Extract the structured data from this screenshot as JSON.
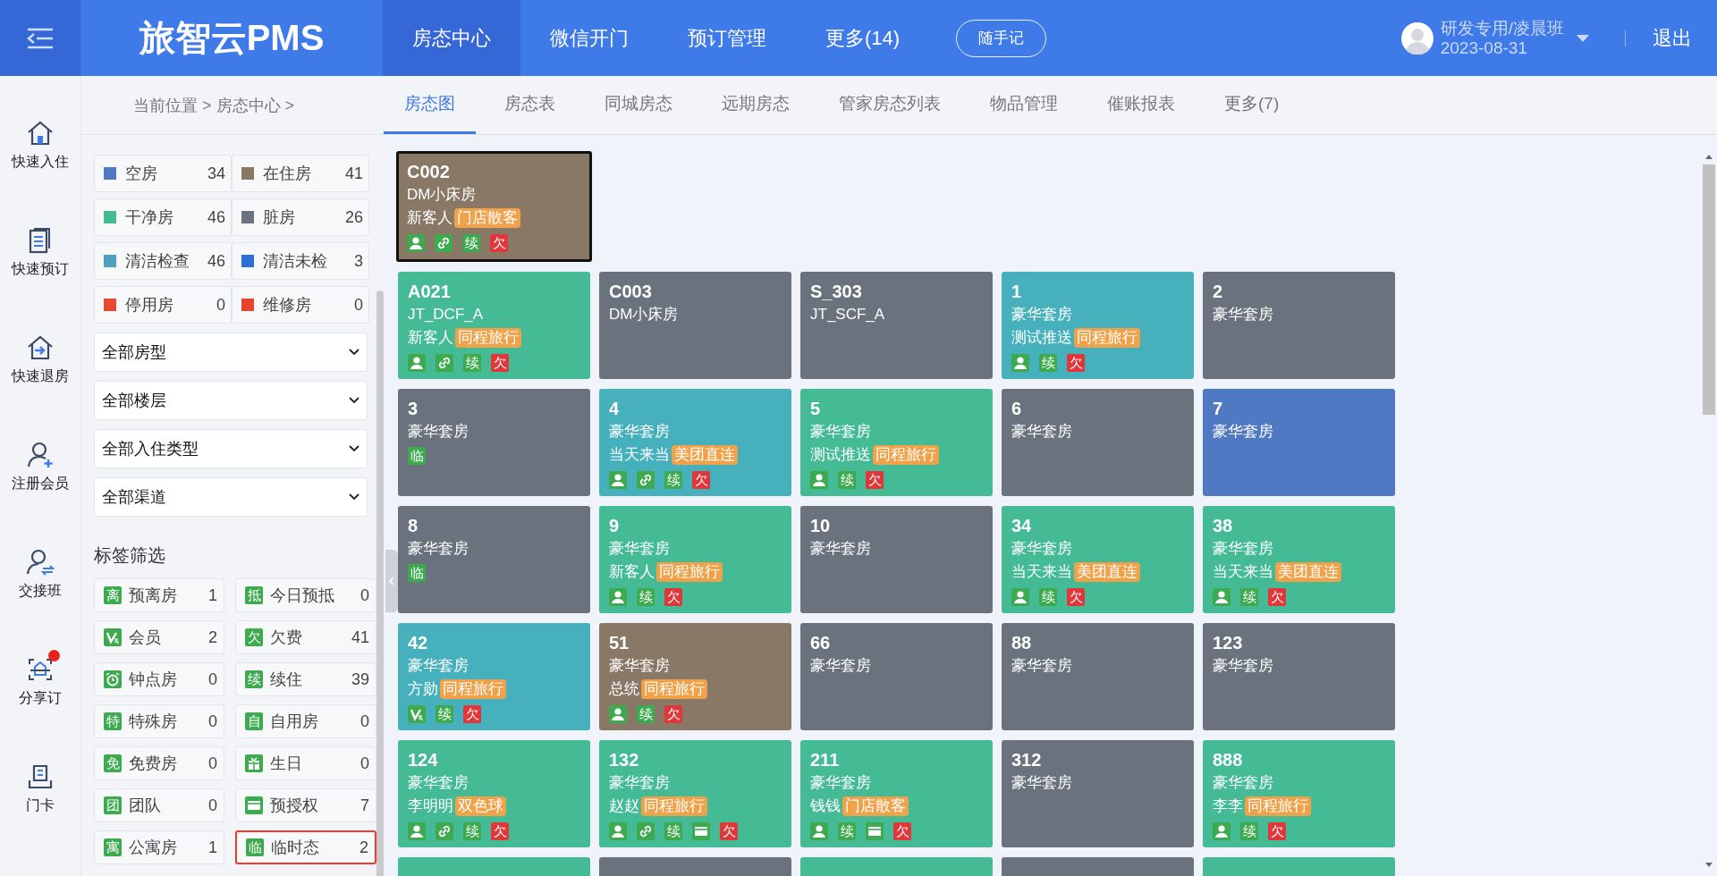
{
  "header": {
    "logo": "旅智云PMS",
    "nav": [
      {
        "label": "房态中心",
        "selected": true
      },
      {
        "label": "微信开门",
        "selected": false
      },
      {
        "label": "预订管理",
        "selected": false
      },
      {
        "label": "更多(14)",
        "selected": false
      }
    ],
    "note_button": "随手记",
    "user": {
      "name": "研发专用/凌晨班",
      "date": "2023-08-31"
    },
    "logout": "退出"
  },
  "rail": [
    {
      "label": "快速入住",
      "kind": "checkin",
      "alert": false
    },
    {
      "label": "快速预订",
      "kind": "booking",
      "alert": false
    },
    {
      "label": "快速退房",
      "kind": "checkout",
      "alert": false
    },
    {
      "label": "注册会员",
      "kind": "member",
      "alert": false
    },
    {
      "label": "交接班",
      "kind": "handover",
      "alert": false
    },
    {
      "label": "分享订",
      "kind": "share",
      "alert": true
    },
    {
      "label": "门卡",
      "kind": "card",
      "alert": false
    }
  ],
  "breadcrumb": "当前位置 > 房态中心 >",
  "tabs": [
    {
      "label": "房态图",
      "selected": true
    },
    {
      "label": "房态表",
      "selected": false
    },
    {
      "label": "同城房态",
      "selected": false
    },
    {
      "label": "远期房态",
      "selected": false
    },
    {
      "label": "管家房态列表",
      "selected": false
    },
    {
      "label": "物品管理",
      "selected": false
    },
    {
      "label": "催账报表",
      "selected": false
    },
    {
      "label": "更多(7)",
      "selected": false
    }
  ],
  "status_filters": [
    {
      "label": "空房",
      "count": "34",
      "color": "#5079c3"
    },
    {
      "label": "在住房",
      "count": "41",
      "color": "#8a7866"
    },
    {
      "label": "干净房",
      "count": "46",
      "color": "#45bb95"
    },
    {
      "label": "脏房",
      "count": "26",
      "color": "#6a737d"
    },
    {
      "label": "清洁检查",
      "count": "46",
      "color": "#4f9fc0"
    },
    {
      "label": "清洁未检",
      "count": "3",
      "color": "#2d6fd6"
    },
    {
      "label": "停用房",
      "count": "0",
      "color": "#e84a2f"
    },
    {
      "label": "维修房",
      "count": "0",
      "color": "#e6452b"
    }
  ],
  "selects": [
    "全部房型",
    "全部楼层",
    "全部入住类型",
    "全部渠道"
  ],
  "tag_filter": {
    "title": "标签筛选",
    "items": [
      {
        "kind": "text",
        "mark": "离",
        "label": "预离房",
        "count": "1",
        "selected": false
      },
      {
        "kind": "text",
        "mark": "抵",
        "label": "今日预抵",
        "count": "0",
        "selected": false
      },
      {
        "kind": "vip",
        "label": "会员",
        "count": "2",
        "selected": false
      },
      {
        "kind": "text",
        "mark": "欠",
        "label": "欠费",
        "count": "41",
        "selected": false
      },
      {
        "kind": "clock",
        "label": "钟点房",
        "count": "0",
        "selected": false
      },
      {
        "kind": "text",
        "mark": "续",
        "label": "续住",
        "count": "39",
        "selected": false
      },
      {
        "kind": "text",
        "mark": "特",
        "label": "特殊房",
        "count": "0",
        "selected": false
      },
      {
        "kind": "text",
        "mark": "自",
        "label": "自用房",
        "count": "0",
        "selected": false
      },
      {
        "kind": "text",
        "mark": "免",
        "label": "免费房",
        "count": "0",
        "selected": false
      },
      {
        "kind": "gift",
        "label": "生日",
        "count": "0",
        "selected": false
      },
      {
        "kind": "text",
        "mark": "团",
        "label": "团队",
        "count": "0",
        "selected": false
      },
      {
        "kind": "card",
        "label": "预授权",
        "count": "7",
        "selected": false
      },
      {
        "kind": "text",
        "mark": "寓",
        "label": "公寓房",
        "count": "1",
        "selected": false
      },
      {
        "kind": "text",
        "mark": "临",
        "label": "临时态",
        "count": "2",
        "selected": true
      }
    ]
  },
  "room_rows": [
    [
      {
        "number": "C002",
        "type": "DM小床房",
        "guest": "新客人",
        "channel": "门店散客",
        "color": "#8a7866",
        "selected": true,
        "badges": [
          {
            "kind": "guest"
          },
          {
            "kind": "link"
          },
          {
            "kind": "text",
            "text": "续",
            "color": "#3eaa4f"
          },
          {
            "kind": "text",
            "text": "欠",
            "color": "#e0373a"
          }
        ]
      }
    ],
    [
      {
        "number": "A021",
        "type": "JT_DCF_A",
        "guest": "新客人",
        "channel": "同程旅行",
        "color": "#45bb95",
        "selected": false,
        "badges": [
          {
            "kind": "guest"
          },
          {
            "kind": "link"
          },
          {
            "kind": "text",
            "text": "续",
            "color": "#3eaa4f"
          },
          {
            "kind": "text",
            "text": "欠",
            "color": "#e0373a"
          }
        ]
      },
      {
        "number": "C003",
        "type": "DM小床房",
        "color": "#6a737d",
        "selected": false
      },
      {
        "number": "S_303",
        "type": "JT_SCF_A",
        "color": "#6a737d",
        "selected": false
      },
      {
        "number": "1",
        "type": "豪华套房",
        "guest": "测试推送",
        "channel": "同程旅行",
        "color": "#46b1bd",
        "selected": false,
        "badges": [
          {
            "kind": "guest"
          },
          {
            "kind": "text",
            "text": "续",
            "color": "#3eaa4f"
          },
          {
            "kind": "text",
            "text": "欠",
            "color": "#e0373a"
          }
        ]
      },
      {
        "number": "2",
        "type": "豪华套房",
        "color": "#6a737d",
        "selected": false
      }
    ],
    [
      {
        "number": "3",
        "type": "豪华套房",
        "color": "#6a737d",
        "selected": false,
        "badges": [
          {
            "kind": "text",
            "text": "临",
            "color": "#3eaa4f"
          }
        ]
      },
      {
        "number": "4",
        "type": "豪华套房",
        "guest": "当天来当",
        "channel": "美团直连",
        "color": "#46b1bd",
        "selected": false,
        "badges": [
          {
            "kind": "guest"
          },
          {
            "kind": "link"
          },
          {
            "kind": "text",
            "text": "续",
            "color": "#3eaa4f"
          },
          {
            "kind": "text",
            "text": "欠",
            "color": "#e0373a"
          }
        ]
      },
      {
        "number": "5",
        "type": "豪华套房",
        "guest": "测试推送",
        "channel": "同程旅行",
        "color": "#45bb95",
        "selected": false,
        "badges": [
          {
            "kind": "guest"
          },
          {
            "kind": "text",
            "text": "续",
            "color": "#3eaa4f"
          },
          {
            "kind": "text",
            "text": "欠",
            "color": "#e0373a"
          }
        ]
      },
      {
        "number": "6",
        "type": "豪华套房",
        "color": "#6a737d",
        "selected": false
      },
      {
        "number": "7",
        "type": "豪华套房",
        "color": "#5079c3",
        "selected": false
      }
    ],
    [
      {
        "number": "8",
        "type": "豪华套房",
        "color": "#6a737d",
        "selected": false,
        "badges": [
          {
            "kind": "text",
            "text": "临",
            "color": "#3eaa4f"
          }
        ]
      },
      {
        "number": "9",
        "type": "豪华套房",
        "guest": "新客人",
        "channel": "同程旅行",
        "color": "#45bb95",
        "selected": false,
        "badges": [
          {
            "kind": "guest"
          },
          {
            "kind": "text",
            "text": "续",
            "color": "#3eaa4f"
          },
          {
            "kind": "text",
            "text": "欠",
            "color": "#e0373a"
          }
        ]
      },
      {
        "number": "10",
        "type": "豪华套房",
        "color": "#6a737d",
        "selected": false
      },
      {
        "number": "34",
        "type": "豪华套房",
        "guest": "当天来当",
        "channel": "美团直连",
        "color": "#45bb95",
        "selected": false,
        "badges": [
          {
            "kind": "guest"
          },
          {
            "kind": "text",
            "text": "续",
            "color": "#3eaa4f"
          },
          {
            "kind": "text",
            "text": "欠",
            "color": "#e0373a"
          }
        ]
      },
      {
        "number": "38",
        "type": "豪华套房",
        "guest": "当天来当",
        "channel": "美团直连",
        "color": "#45bb95",
        "selected": false,
        "badges": [
          {
            "kind": "guest"
          },
          {
            "kind": "text",
            "text": "续",
            "color": "#3eaa4f"
          },
          {
            "kind": "text",
            "text": "欠",
            "color": "#e0373a"
          }
        ]
      }
    ],
    [
      {
        "number": "42",
        "type": "豪华套房",
        "guest": "方勋",
        "channel": "同程旅行",
        "color": "#46b1bd",
        "selected": false,
        "badges": [
          {
            "kind": "vip"
          },
          {
            "kind": "text",
            "text": "续",
            "color": "#3eaa4f"
          },
          {
            "kind": "text",
            "text": "欠",
            "color": "#e0373a"
          }
        ]
      },
      {
        "number": "51",
        "type": "豪华套房",
        "guest": "总统",
        "channel": "同程旅行",
        "color": "#8a7866",
        "selected": false,
        "badges": [
          {
            "kind": "guest"
          },
          {
            "kind": "text",
            "text": "续",
            "color": "#3eaa4f"
          },
          {
            "kind": "text",
            "text": "欠",
            "color": "#e0373a"
          }
        ]
      },
      {
        "number": "66",
        "type": "豪华套房",
        "color": "#6a737d",
        "selected": false
      },
      {
        "number": "88",
        "type": "豪华套房",
        "color": "#6a737d",
        "selected": false
      },
      {
        "number": "123",
        "type": "豪华套房",
        "color": "#6a737d",
        "selected": false
      }
    ],
    [
      {
        "number": "124",
        "type": "豪华套房",
        "guest": "李明明",
        "channel": "双色球",
        "color": "#45bb95",
        "selected": false,
        "badges": [
          {
            "kind": "guest"
          },
          {
            "kind": "link"
          },
          {
            "kind": "text",
            "text": "续",
            "color": "#3eaa4f"
          },
          {
            "kind": "text",
            "text": "欠",
            "color": "#e0373a"
          }
        ]
      },
      {
        "number": "132",
        "type": "豪华套房",
        "guest": "赵赵",
        "channel": "同程旅行",
        "color": "#45bb95",
        "selected": false,
        "badges": [
          {
            "kind": "guest"
          },
          {
            "kind": "link"
          },
          {
            "kind": "text",
            "text": "续",
            "color": "#3eaa4f"
          },
          {
            "kind": "card"
          },
          {
            "kind": "text",
            "text": "欠",
            "color": "#e0373a"
          }
        ]
      },
      {
        "number": "211",
        "type": "豪华套房",
        "guest": "钱钱",
        "channel": "门店散客",
        "color": "#45bb95",
        "selected": false,
        "badges": [
          {
            "kind": "guest"
          },
          {
            "kind": "text",
            "text": "续",
            "color": "#3eaa4f"
          },
          {
            "kind": "card"
          },
          {
            "kind": "text",
            "text": "欠",
            "color": "#e0373a"
          }
        ]
      },
      {
        "number": "312",
        "type": "豪华套房",
        "color": "#6a737d",
        "selected": false
      },
      {
        "number": "888",
        "type": "豪华套房",
        "guest": "李李",
        "channel": "同程旅行",
        "color": "#45bb95",
        "selected": false,
        "badges": [
          {
            "kind": "guest"
          },
          {
            "kind": "text",
            "text": "续",
            "color": "#3eaa4f"
          },
          {
            "kind": "text",
            "text": "欠",
            "color": "#e0373a"
          }
        ]
      }
    ],
    [
      {
        "color": "#45bb95",
        "selected": false
      },
      {
        "color": "#6a737d",
        "selected": false
      },
      {
        "color": "#45bb95",
        "selected": false
      },
      {
        "color": "#6a737d",
        "selected": false
      },
      {
        "color": "#45bb95",
        "selected": false
      }
    ]
  ]
}
